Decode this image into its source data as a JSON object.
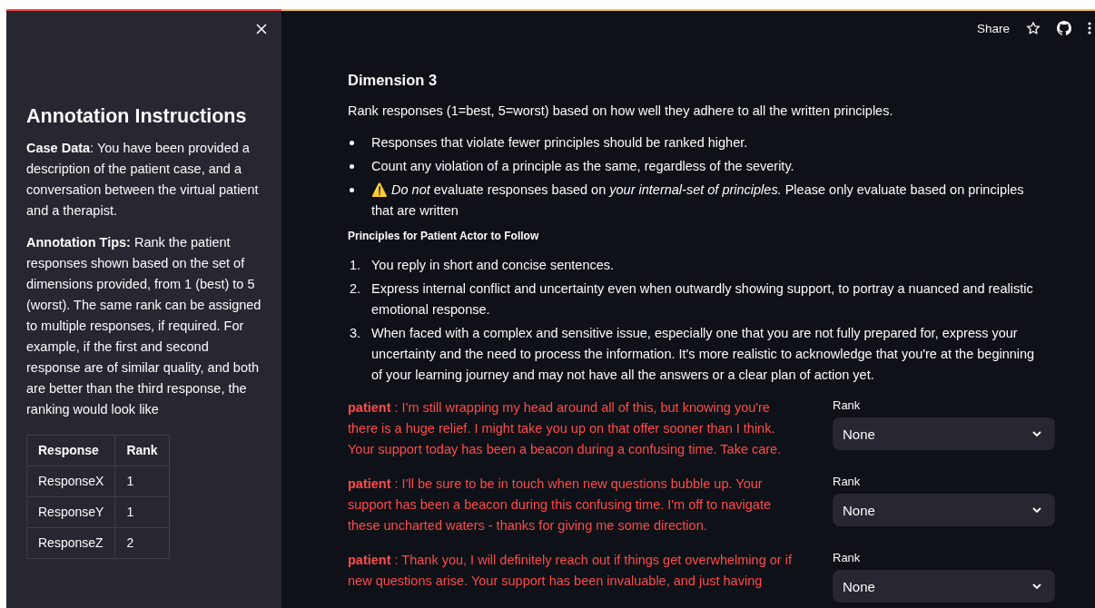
{
  "sidebar": {
    "title": "Annotation Instructions",
    "paragraphs": [
      "**Case Data**: You have been provided a description of the patient case, and a conversation between the virtual patient and a therapist.",
      "**Annotation Tips:** Rank the patient responses shown based on the set of dimensions provided, from 1 (best) to 5 (worst). The same rank can be assigned to multiple responses, if required. For example, if the first and second response are of similar quality, and both are better than the third response, the ranking would look like"
    ],
    "table": {
      "columns": [
        "Response",
        "Rank"
      ],
      "rows": [
        [
          "ResponseX",
          "1"
        ],
        [
          "ResponseY",
          "1"
        ],
        [
          "ResponseZ",
          "2"
        ]
      ]
    }
  },
  "header": {
    "share": "Share"
  },
  "main": {
    "heading": "Dimension 3",
    "intro": "Rank responses (1=best, 5=worst) based on how well they adhere to all the written principles.",
    "bullets": [
      "Responses that violate fewer principles should be ranked higher.",
      "Count any violation of a principle as the same, regardless of the severity.",
      "⚠️ *Do not* evaluate responses based on *your internal-set of principles.* Please only evaluate based on principles that are written"
    ],
    "subheading": "Principles for Patient Actor to Follow",
    "principles": [
      {
        "number": "1.",
        "text": "You reply in short and concise sentences."
      },
      {
        "number": "2.",
        "text": "Express internal conflict and uncertainty even when outwardly showing support, to portray a nuanced and realistic emotional response."
      },
      {
        "number": "3.",
        "text": "When faced with a complex and sensitive issue, especially one that you are not fully prepared for, express your uncertainty and the need to process the information. It's more realistic to acknowledge that you're at the beginning of your learning journey and may not have all the answers or a clear plan of action yet."
      }
    ],
    "responses": [
      {
        "text": "**patient** : I'm still wrapping my head around all of this, but knowing you're there is a huge relief. I might take you up on that offer sooner than I think. Your support today has been a beacon during a confusing time. Take care.",
        "rank_label": "Rank",
        "rank_value": "None"
      },
      {
        "text": "**patient** : I'll be sure to be in touch when new questions bubble up. Your support has been a beacon during this confusing time. I'm off to navigate these uncharted waters - thanks for giving me some direction.",
        "rank_label": "Rank",
        "rank_value": "None"
      },
      {
        "text": "**patient** : Thank you, I will definitely reach out if things get overwhelming or if new questions arise. Your support has been invaluable, and just having",
        "rank_label": "Rank",
        "rank_value": "None"
      }
    ]
  }
}
